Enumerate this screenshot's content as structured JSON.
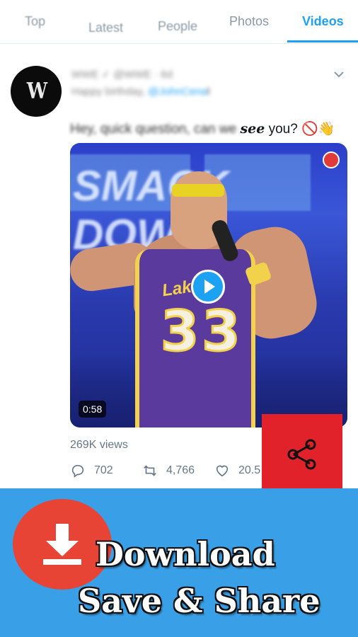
{
  "tabs": [
    {
      "label": "Top"
    },
    {
      "label": "Latest"
    },
    {
      "label": "People"
    },
    {
      "label": "Photos"
    },
    {
      "label": "Videos",
      "active": true
    }
  ],
  "tweet": {
    "avatar_logo": "W",
    "author_blurred": "WWE ✓ @WWE · 6d",
    "reply_prefix_blurred": "Happy birthday, ",
    "reply_mention_blurred": "@JohnCena",
    "reply_suffix": "!",
    "text_blurred": "Hey, quick question, can we ",
    "text_emph": "see",
    "text_end": " you? 🚫👋",
    "video": {
      "duration": "0:58",
      "jersey_word": "Lakers",
      "jersey_number": "33",
      "sign_text": "SMACK DOWN"
    },
    "views": "269K views",
    "replies": "702",
    "retweets": "4,766",
    "likes": "20.5"
  },
  "promo": {
    "line1": "Download",
    "line2": "Save & Share",
    "colors": {
      "banner": "#39a0e8",
      "download": "#e84436",
      "share": "#e2222a"
    }
  },
  "icons": [
    "chevron-down-icon",
    "play-icon",
    "reply-icon",
    "retweet-icon",
    "like-icon",
    "share-icon",
    "download-icon"
  ]
}
